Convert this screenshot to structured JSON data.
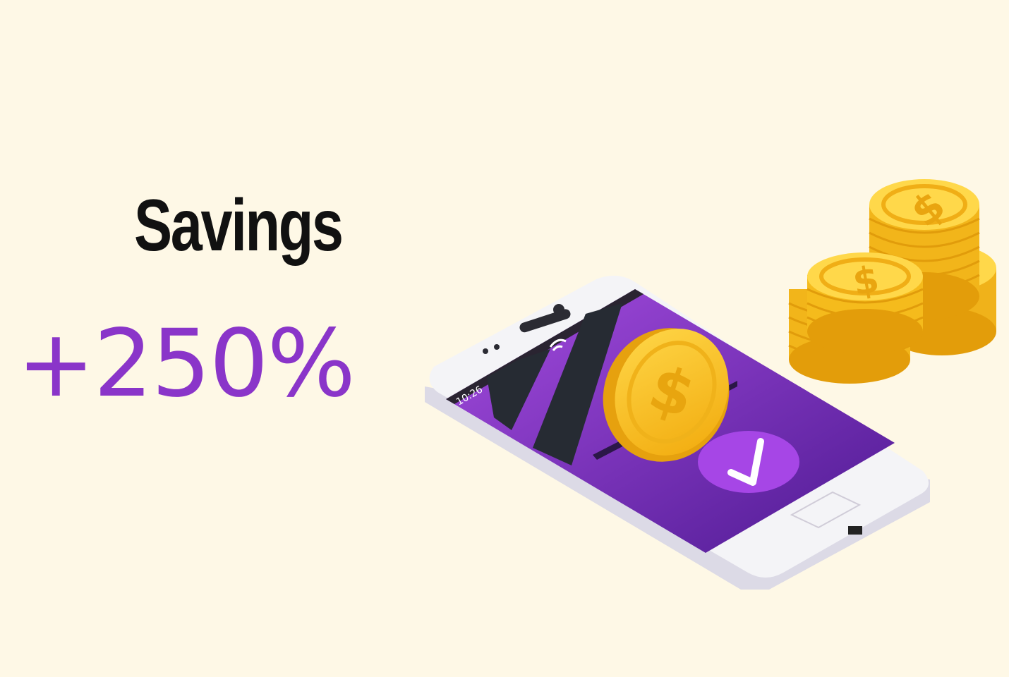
{
  "headline": {
    "title": "Savings",
    "value": "+250%"
  },
  "illustration": {
    "phone_time": "10:26",
    "icons": [
      "smartphone-icon",
      "dollar-coin-icon",
      "checkmark-icon",
      "wifi-icon",
      "coin-stack-icon"
    ]
  },
  "colors": {
    "background": "#fef8e6",
    "accent_purple": "#8a35c9",
    "screen_purple": "#6a22b8",
    "coin_gold": "#f8c21a",
    "title_black": "#111111"
  }
}
